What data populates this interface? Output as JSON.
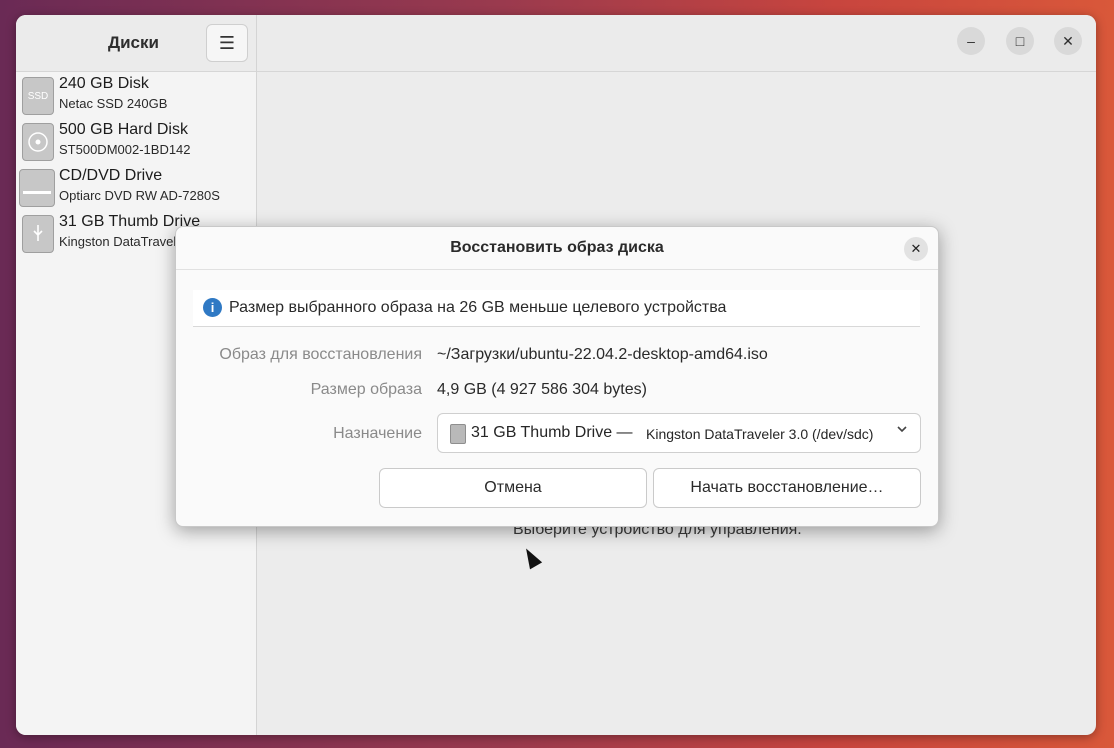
{
  "app": {
    "title": "Диски",
    "menu_icon": "hamburger-icon"
  },
  "disks": [
    {
      "title": "240 GB Disk",
      "subtitle": "Netac SSD 240GB",
      "icon": "ssd-icon",
      "icon_text": "SSD"
    },
    {
      "title": "500 GB Hard Disk",
      "subtitle": "ST500DM002-1BD142",
      "icon": "hdd-icon",
      "icon_text": ""
    },
    {
      "title": "CD/DVD Drive",
      "subtitle": "Optiarc DVD RW AD-7280S",
      "icon": "optical-drive-icon",
      "icon_text": ""
    },
    {
      "title": "31 GB Thumb Drive",
      "subtitle": "Kingston DataTraveler 3.0",
      "icon": "usb-drive-icon",
      "icon_text": ""
    }
  ],
  "main": {
    "empty_hint": "Выберите устройство для управления."
  },
  "window_controls": {
    "minimize": "–",
    "maximize": "□",
    "close": "✕"
  },
  "dialog": {
    "title": "Восстановить образ диска",
    "close_glyph": "✕",
    "info_text": "Размер выбранного образа на 26 GB меньше целевого устройства",
    "image_label": "Образ для восстановления",
    "image_value": "~/Загрузки/ubuntu-22.04.2-desktop-amd64.iso",
    "size_label": "Размер образа",
    "size_value": "4,9 GB (4 927 586 304 bytes)",
    "dest_label": "Назначение",
    "dest_main": "31 GB Thumb Drive —",
    "dest_sub": "Kingston DataTraveler 3.0 (/dev/sdc)",
    "cancel_label": "Отмена",
    "start_label": "Начать восстановление…"
  },
  "colors": {
    "accent_info": "#2f79c4"
  }
}
